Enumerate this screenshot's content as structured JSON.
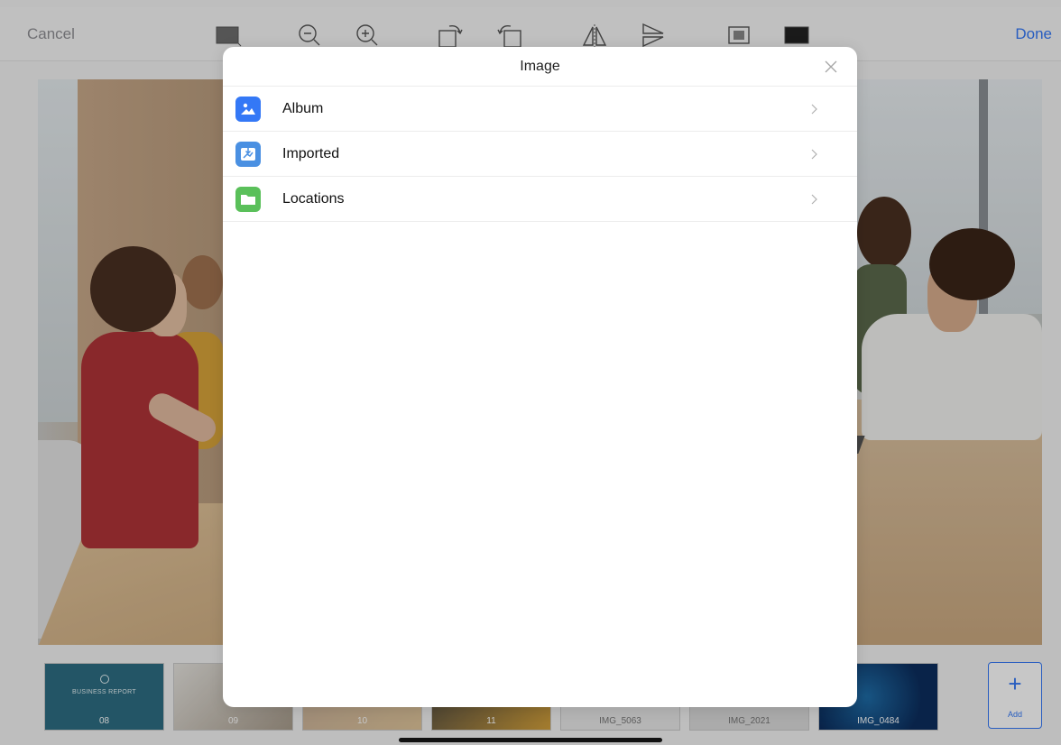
{
  "toolbar": {
    "cancel_label": "Cancel",
    "done_label": "Done",
    "accent": "#3478f6",
    "tools": [
      "frame-icon",
      "zoom-out-icon",
      "zoom-in-icon",
      "rotate-right-icon",
      "rotate-left-icon",
      "flip-horizontal-icon",
      "flip-vertical-icon",
      "crop-icon",
      "fill-icon"
    ]
  },
  "thumbnails": [
    {
      "label": "08",
      "title": "BUSINESS REPORT"
    },
    {
      "label": "09"
    },
    {
      "label": "10"
    },
    {
      "label": "11"
    },
    {
      "label": "IMG_5063"
    },
    {
      "label": "IMG_2021"
    },
    {
      "label": "IMG_0484"
    }
  ],
  "add_button": {
    "label": "Add",
    "symbol": "+"
  },
  "modal": {
    "title": "Image",
    "items": [
      {
        "label": "Album",
        "icon": "album-icon",
        "color": "#3478f6"
      },
      {
        "label": "Imported",
        "icon": "imported-icon",
        "color": "#4a90e2"
      },
      {
        "label": "Locations",
        "icon": "folder-icon",
        "color": "#5ac05a"
      }
    ]
  }
}
